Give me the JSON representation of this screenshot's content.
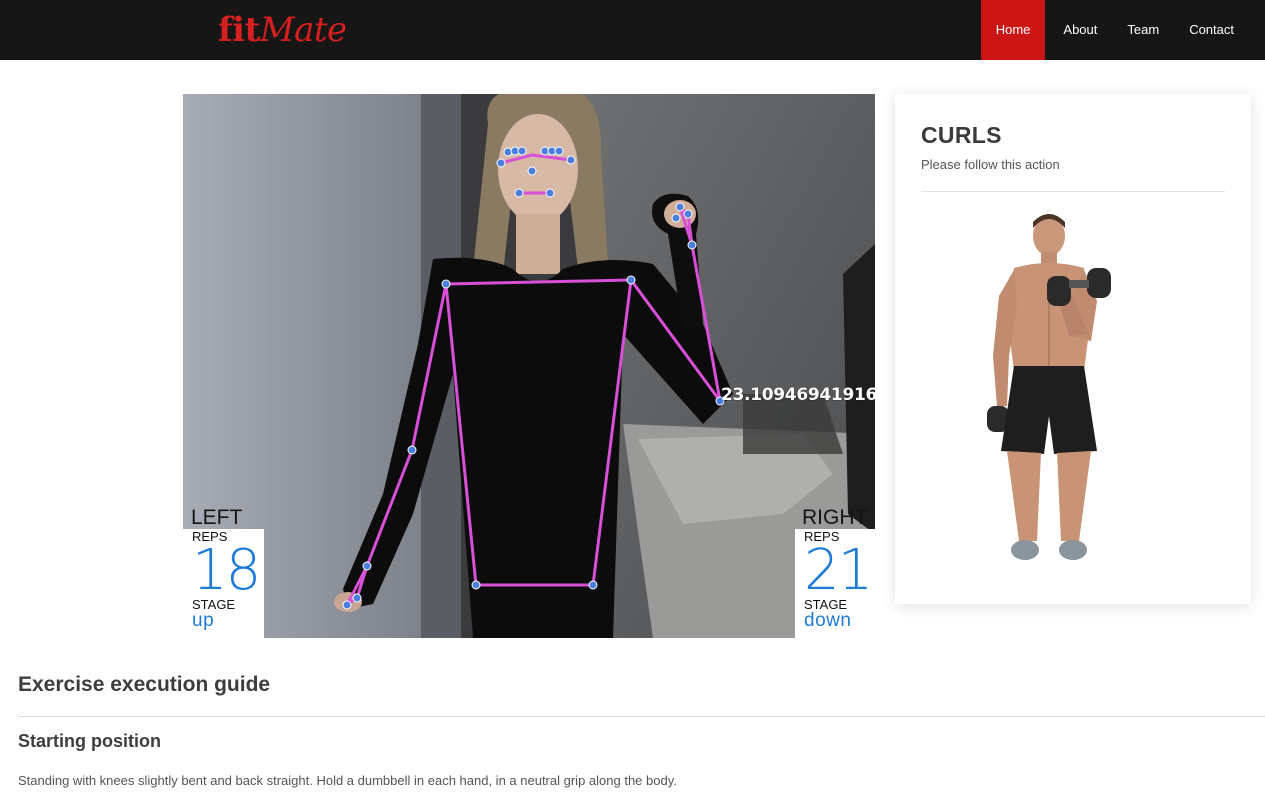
{
  "brand": {
    "part1": "fit",
    "part2": "Mate",
    "color": "#d61f1f"
  },
  "nav": {
    "items": [
      {
        "label": "Home",
        "active": true
      },
      {
        "label": "About",
        "active": false
      },
      {
        "label": "Team",
        "active": false
      },
      {
        "label": "Contact",
        "active": false
      }
    ],
    "active_color": "#cc1616"
  },
  "feed": {
    "angle_readout": "23.10946941916",
    "left": {
      "side": "LEFT",
      "reps_label": "REPS",
      "reps": "18",
      "stage_label": "STAGE",
      "stage": "up"
    },
    "right": {
      "side": "RIGHT",
      "reps_label": "REPS",
      "reps": "21",
      "stage_label": "STAGE",
      "stage": "down"
    },
    "skeleton_color": "#d84fd8",
    "keypoint_color": "#4a7fe0",
    "counter_color": "#1e7cd8"
  },
  "exercise_card": {
    "title": "CURLS",
    "subtitle": "Please follow this action"
  },
  "guide": {
    "title": "Exercise execution guide",
    "section_title": "Starting position",
    "text": "Standing with knees slightly bent and back straight. Hold a dumbbell in each hand, in a neutral grip along the body."
  }
}
